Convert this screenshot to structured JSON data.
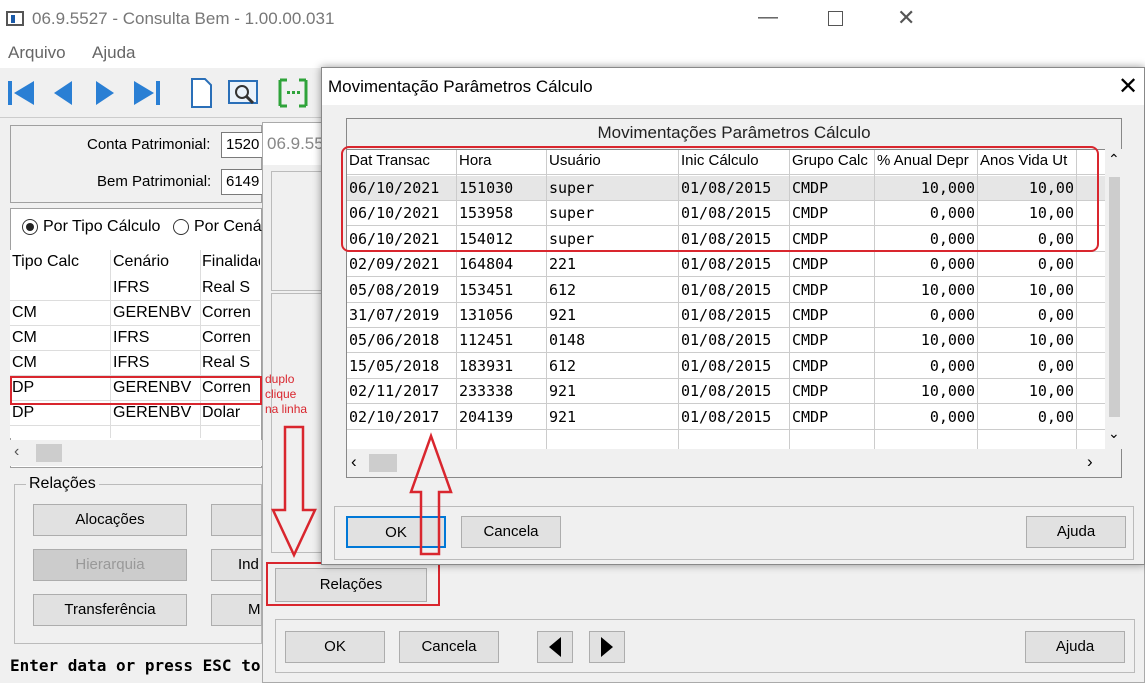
{
  "main_window": {
    "title": "06.9.5527 - Consulta Bem - 1.00.00.031",
    "menu": [
      "Arquivo",
      "Ajuda"
    ],
    "conta_label": "Conta Patrimonial:",
    "conta_value": "1520",
    "bem_label": "Bem Patrimonial:",
    "bem_value": "6149",
    "radio1": "Por Tipo Cálculo",
    "radio2": "Por Cenário",
    "grid_headers": [
      "Tipo Calc",
      "Cenário",
      "Finalidade"
    ],
    "grid_rows": [
      [
        "",
        "IFRS",
        "Real S"
      ],
      [
        "CM",
        "GERENBV",
        "Corren"
      ],
      [
        "CM",
        "IFRS",
        "Corren"
      ],
      [
        "CM",
        "IFRS",
        "Real S"
      ],
      [
        "DP",
        "GERENBV",
        "Corren"
      ],
      [
        "DP",
        "GERENBV",
        "Dolar"
      ]
    ],
    "relacoes_group": "Relações",
    "btn_alocacoes": "Alocações",
    "btn_hierarquia": "Hierarquia",
    "btn_transferencia": "Transferência",
    "btn_ind": "Ind",
    "btn_m": "M",
    "status": "Enter data or press ESC to"
  },
  "middle_window": {
    "title": "06.9.55",
    "btn_relacoes": "Relações",
    "btn_ok": "OK",
    "btn_cancela": "Cancela",
    "btn_ajuda": "Ajuda"
  },
  "dialog": {
    "title": "Movimentação Parâmetros Cálculo",
    "grid_title": "Movimentações Parâmetros Cálculo",
    "columns": [
      "Dat Transac",
      "Hora",
      "Usuário",
      "Inic Cálculo",
      "Grupo Calc",
      "% Anual Depr",
      "Anos Vida Ut"
    ],
    "rows": [
      [
        "06/10/2021",
        "151030",
        "super",
        "01/08/2015",
        "CMDP",
        "10,000",
        "10,00"
      ],
      [
        "06/10/2021",
        "153958",
        "super",
        "01/08/2015",
        "CMDP",
        "0,000",
        "10,00"
      ],
      [
        "06/10/2021",
        "154012",
        "super",
        "01/08/2015",
        "CMDP",
        "0,000",
        "0,00"
      ],
      [
        "02/09/2021",
        "164804",
        "221",
        "01/08/2015",
        "CMDP",
        "0,000",
        "0,00"
      ],
      [
        "05/08/2019",
        "153451",
        "612",
        "01/08/2015",
        "CMDP",
        "10,000",
        "10,00"
      ],
      [
        "31/07/2019",
        "131056",
        "921",
        "01/08/2015",
        "CMDP",
        "0,000",
        "0,00"
      ],
      [
        "05/06/2018",
        "112451",
        "0148",
        "01/08/2015",
        "CMDP",
        "10,000",
        "10,00"
      ],
      [
        "15/05/2018",
        "183931",
        "612",
        "01/08/2015",
        "CMDP",
        "0,000",
        "0,00"
      ],
      [
        "02/11/2017",
        "233338",
        "921",
        "01/08/2015",
        "CMDP",
        "10,000",
        "10,00"
      ],
      [
        "02/10/2017",
        "204139",
        "921",
        "01/08/2015",
        "CMDP",
        "0,000",
        "0,00"
      ]
    ],
    "btn_ok": "OK",
    "btn_cancela": "Cancela",
    "btn_ajuda": "Ajuda"
  },
  "annotation": {
    "text_line1": "duplo",
    "text_line2": "clique",
    "text_line3": "na linha"
  },
  "colors": {
    "annotation_red": "#d9262e",
    "selection": "#e6e6e6"
  }
}
